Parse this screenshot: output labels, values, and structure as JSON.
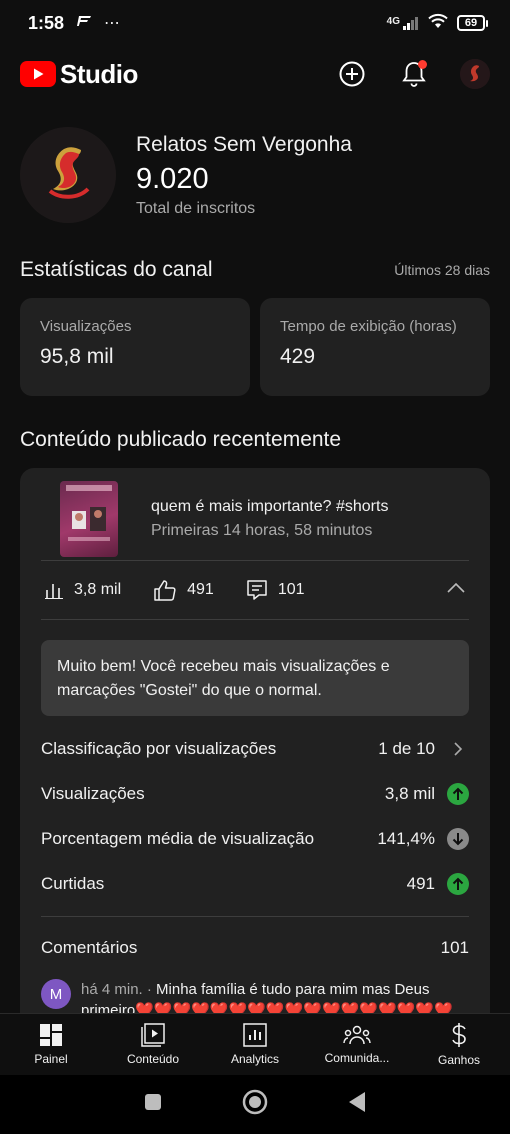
{
  "status_bar": {
    "time": "1:58",
    "network": "4G",
    "battery": "69"
  },
  "header": {
    "logo_text": "Studio",
    "brand_color": "#ff0000",
    "icons": [
      "create-icon",
      "bell-icon",
      "account-avatar"
    ]
  },
  "channel": {
    "name": "Relatos Sem Vergonha",
    "subscribers": "9.020",
    "subscribers_label": "Total de inscritos"
  },
  "stats": {
    "title": "Estatísticas do canal",
    "period": "Últimos 28 dias",
    "cards": [
      {
        "label": "Visualizações",
        "value": "95,8 mil"
      },
      {
        "label": "Tempo de exibição (horas)",
        "value": "429"
      }
    ]
  },
  "recent": {
    "title": "Conteúdo publicado recentemente",
    "video": {
      "title": "quem é mais importante? #shorts",
      "subtitle": "Primeiras 14 horas, 58 minutos"
    },
    "metrics": {
      "views": "3,8 mil",
      "likes": "491",
      "comments": "101"
    },
    "banner": "Muito bem! Você recebeu mais visualizações e marcações \"Gostei\" do que o normal.",
    "rows": [
      {
        "label": "Classificação por visualizações",
        "value": "1 de 10",
        "indicator": "chevron"
      },
      {
        "label": "Visualizações",
        "value": "3,8 mil",
        "indicator": "up"
      },
      {
        "label": "Porcentagem média de visualização",
        "value": "141,4%",
        "indicator": "down"
      },
      {
        "label": "Curtidas",
        "value": "491",
        "indicator": "up"
      }
    ],
    "comments": {
      "label": "Comentários",
      "count": "101",
      "first": {
        "avatar_letter": "M",
        "time": "há 4 min.",
        "text": "Minha família é tudo para mim mas Deus primeiro❤️❤️❤️❤️❤️❤️❤️❤️❤️❤️❤️❤️❤️❤️❤️❤️❤️"
      }
    }
  },
  "bottom_nav": [
    {
      "label": "Painel",
      "icon": "dashboard-icon"
    },
    {
      "label": "Conteúdo",
      "icon": "content-icon"
    },
    {
      "label": "Analytics",
      "icon": "analytics-icon"
    },
    {
      "label": "Comunida...",
      "icon": "community-icon"
    },
    {
      "label": "Ganhos",
      "icon": "earn-icon"
    }
  ]
}
